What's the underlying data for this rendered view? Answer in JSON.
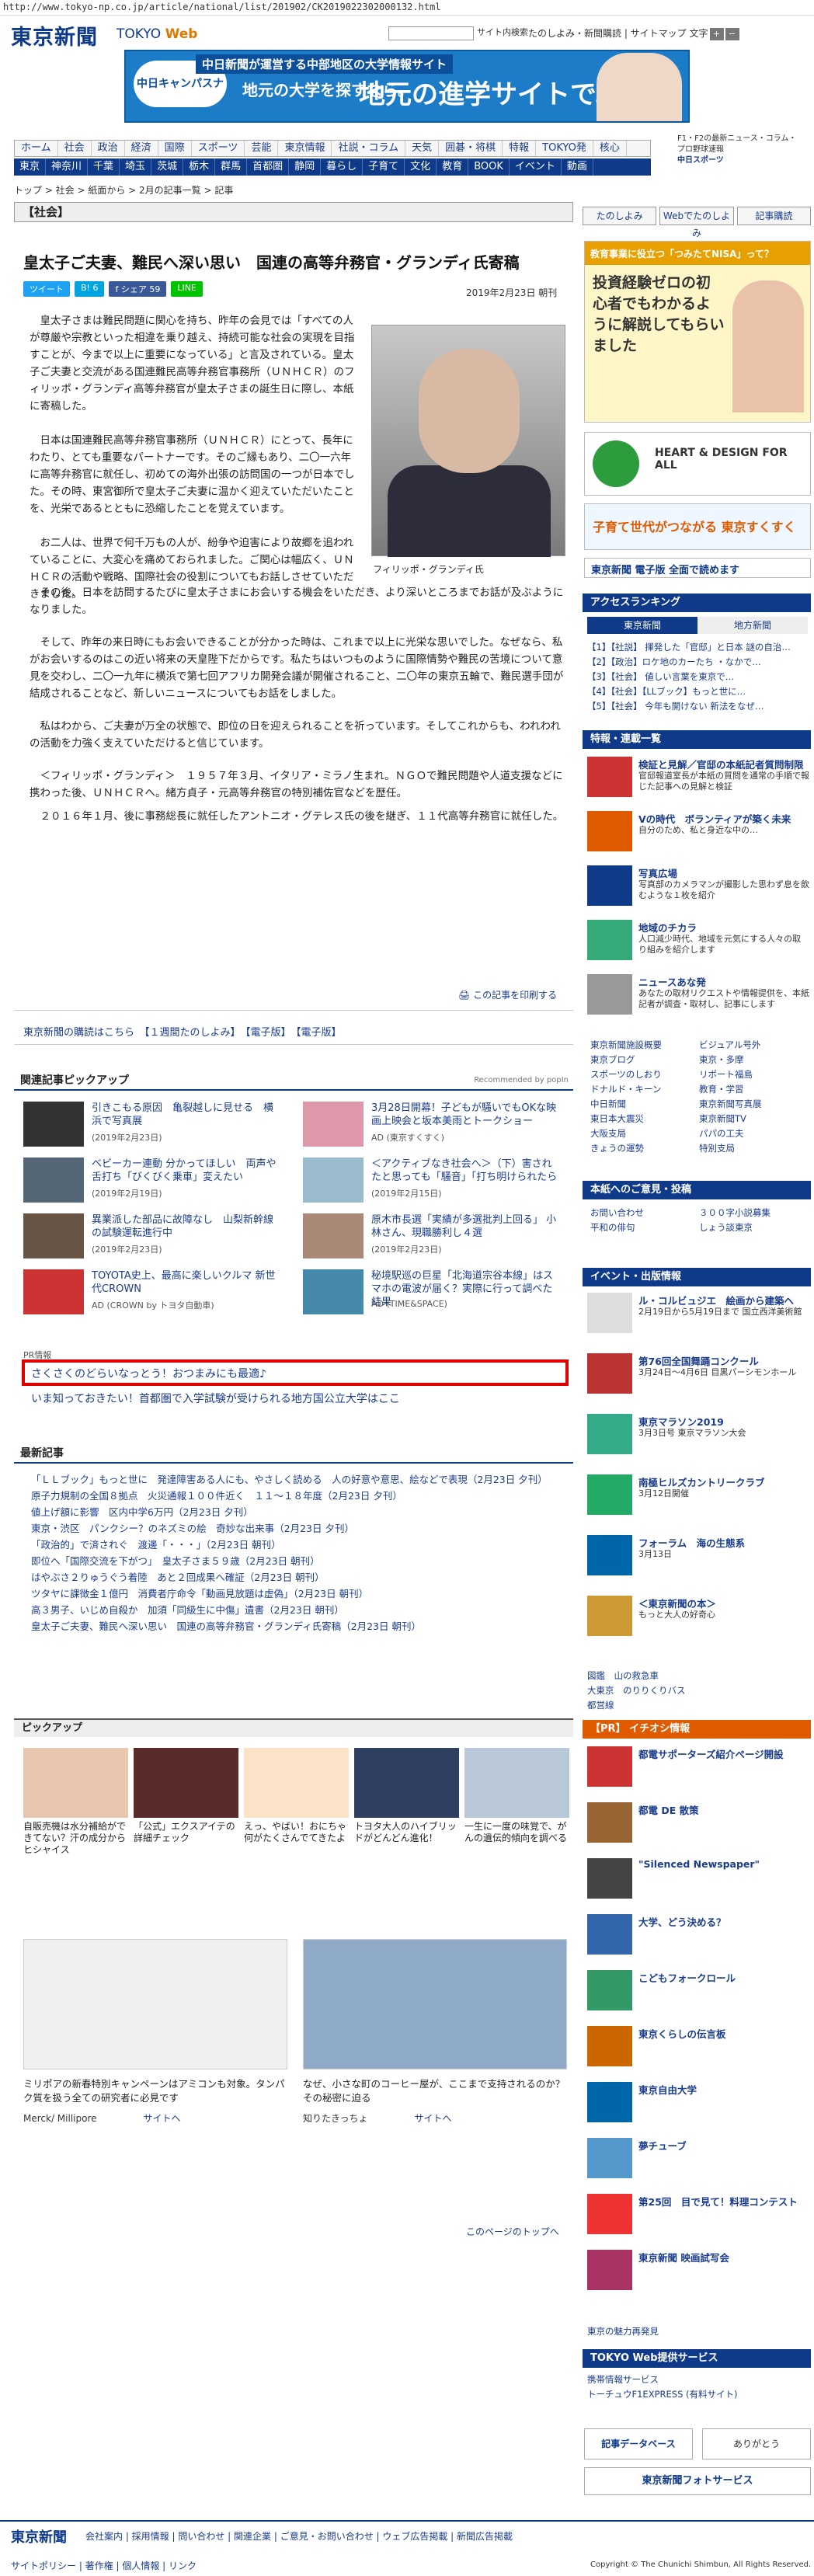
{
  "url": "http://www.tokyo-np.co.jp/article/national/list/201902/CK2019022302000132.html",
  "header": {
    "logo": "東京新聞",
    "logo_sub": "TOKYO",
    "logo_sub2": "Web",
    "search_btn": "サイト内検索",
    "links": "たのしよみ・新聞購読 | サイトマップ",
    "font_label": "文字",
    "font_plus": "+",
    "font_minus": "−"
  },
  "banner": {
    "line1": "中日新聞が運営する中部地区の大学情報サイト",
    "ball": "中日キャンパスナビ",
    "line2": "地元の大学を探すなら。",
    "line3": "地元の進学サイトで。"
  },
  "nav1": [
    "ホーム",
    "社会",
    "政治",
    "経済",
    "国際",
    "スポーツ",
    "芸能",
    "東京情報",
    "社説・コラム",
    "天気",
    "囲碁・将棋",
    "特報",
    "TOKYO発",
    "核心"
  ],
  "nav2": [
    "東京",
    "神奈川",
    "千葉",
    "埼玉",
    "茨城",
    "栃木",
    "群馬",
    "首都圏",
    "静岡",
    "暮らし",
    "子育て",
    "文化",
    "教育",
    "BOOK",
    "イベント",
    "動画"
  ],
  "hdr_right": [
    "F1・F2の最新ニュース・コラム・プロ野球速報",
    "中日スポーツ"
  ],
  "breadcrumb": "トップ > 社会 > 紙面から > 2月の記事一覧 > 記事",
  "category": "【社会】",
  "article": {
    "title": "皇太子ご夫妻、難民へ深い思い　国連の高等弁務官・グランディ氏寄稿",
    "share": [
      "ツイート",
      "B! 6",
      "f シェア 59",
      "LINE"
    ],
    "date": "2019年2月23日 朝刊",
    "p1": "皇太子さまは難民問題に関心を持ち、昨年の会見では「すべての人が尊厳や宗教といった相違を乗り越え、持続可能な社会の実現を目指すことが、今まで以上に重要になっている」と言及されている。皇太子ご夫妻と交流がある国連難民高等弁務官事務所（ＵＮＨＣＲ）のフィリッポ・グランディ高等弁務官が皇太子さまの誕生日に際し、本紙に寄稿した。",
    "p2": "日本は国連難民高等弁務官事務所（ＵＮＨＣＲ）にとって、長年にわたり、とても重要なパートナーです。そのご縁もあり、二〇一六年に高等弁務官に就任し、初めての海外出張の訪問国の一つが日本でした。その時、東宮御所で皇太子ご夫妻に温かく迎えていただいたことを、光栄であるとともに恐縮したことを覚えています。",
    "p3": "お二人は、世界で何千万もの人が、紛争や迫害により故郷を追われていることに、大変心を痛めておられました。ご関心は幅広く、ＵＮＨＣＲの活動や戦略、国際社会の役割についてもお話しさせていただきました。",
    "p4": "その後、日本を訪問するたびに皇太子さまにお会いする機会をいただき、より深いところまでお話が及ぶようになりました。",
    "p5": "そして、昨年の来日時にもお会いできることが分かった時は、これまで以上に光栄な思いでした。なぜなら、私がお会いするのはこの近い将来の天皇陛下だからです。私たちはいつものように国際情勢や難民の苦境について意見を交わし、二〇一九年に横浜で第七回アフリカ開発会議が開催されること、二〇年の東京五輪で、難民選手団が結成されることなど、新しいニュースについてもお話をしました。",
    "p6": "私はわから、ご夫妻が万全の状態で、即位の日を迎えられることを祈っています。そしてこれからも、われわれの活動を力強く支えていただけると信じています。",
    "p7": "＜フィリッポ・グランディ＞　１９５７年３月、イタリア・ミラノ生まれ。ＮＧＯで難民問題や人道支援などに携わった後、ＵＮＨＣＲへ。緒方貞子・元高等弁務官の特別補佐官などを歴任。",
    "p8": "２０１６年１月、後に事務総長に就任したアントニオ・グテレス氏の後を継ぎ、１１代高等弁務官に就任した。",
    "caption": "フィリッポ・グランディ氏",
    "print": "この記事を印刷する"
  },
  "links1": "東京新聞の購読はこちら　【１週間たのしよみ】　【電子版】　【電子版】",
  "related": {
    "heading": "関連記事ピックアップ",
    "powered": "Recommended by popIn",
    "items": [
      {
        "t": "引きこもる原因　亀裂越しに見せる　横浜で写真展",
        "s": "(2019年2月23日)"
      },
      {
        "t": "3月28日開幕！子どもが騒いでもOKな映画上映会と坂本美雨とトークショー",
        "s": "AD (東京すくすく)"
      },
      {
        "t": "ベビーカー連動 分かってほしい　両声や舌打ち「びくびく乗車」変えたい",
        "s": "(2019年2月19日)"
      },
      {
        "t": "＜アクティブなき社会へ＞（下）害されたと思っても「騒音」「打ち明けられたら",
        "s": "(2019年2月15日)"
      },
      {
        "t": "異業派した部品に故障なし　山梨新幹線の試験運転進行中",
        "s": "(2019年2月23日)"
      },
      {
        "t": "原木市長選「実績が多選批判上回る」 小林さん、現職勝利し４選",
        "s": "(2019年2月23日)"
      },
      {
        "t": "TOYOTA史上、最高に楽しいクルマ 新世代CROWN",
        "s": "AD (CROWN by トヨタ自動車)"
      },
      {
        "t": "秘境駅巡の巨星「北海道宗谷本線」はスマホの電波が届く？実際に行って調べた結果",
        "s": "AD (TIME&SPACE)"
      }
    ]
  },
  "pr": {
    "label": "PR情報",
    "item1": "さくさくのどらいなっとう！おつまみにも最適♪",
    "item2": "いま知っておきたい！首都圏で入学試験が受けられる地方国公立大学はここ"
  },
  "latest": {
    "heading": "最新記事",
    "items": [
      "「ＬＬブック」もっと世に　発達障害ある人にも、やさしく読める　人の好意や意思、絵などで表現（2月23日 夕刊）",
      "原子力規制の全国８拠点　火災通報１００件近く　１１～１８年度（2月23日 夕刊）",
      "値上げ額に影響　区内中学6万円（2月23日 夕刊）",
      "東京・渋区　パンクシー？のネズミの絵　奇妙な出来事（2月23日 夕刊）",
      "「政治的」で済されぐ　渡邊「・・・」（2月23日 朝刊）",
      "即位へ「国際交流を下がつ」　皇太子さま５９歳（2月23日 朝刊）",
      "はやぶさ２りゅうぐう着陸　あと２回成果へ確証（2月23日 朝刊）",
      "ツタヤに課徴金１億円　消費者庁命令「動画見放題は虚偽」（2月23日 朝刊）",
      "高３男子、いじめ自殺か　加須「同級生に中傷」遺書（2月23日 朝刊）",
      "皇太子ご夫妻、難民へ深い思い　国連の高等弁務官・グランディ氏寄稿（2月23日 朝刊）"
    ]
  },
  "pickup": {
    "heading": "ピックアップ",
    "items": [
      {
        "t": "自販売機は水分補給ができてない？汗の成分からヒシャイス"
      },
      {
        "t": "「公式」エクスアイテの詳細チェック"
      },
      {
        "t": "えっ、やばい！おにちゃ何がたくさんでてきたよ"
      },
      {
        "t": "トヨタ大人のハイブリッドがどんどん進化！"
      },
      {
        "t": "一生に一度の味覚で、がんの遺伝的傾向を調べる"
      }
    ]
  },
  "ads": [
    {
      "t": "ミリポアの新春特別キャンペーンはアミコンも対象。タンパク質を扱う全ての研究者に必見です",
      "s": "Merck/ Millipore",
      "link": "サイトへ"
    },
    {
      "t": "なぜ、小さな町のコーヒー屋が、ここまで支持されるのか？その秘密に迫る",
      "s": "知りたきっちょ",
      "link": "サイトへ"
    }
  ],
  "totop": "このページのトップへ",
  "side": {
    "buttons": [
      "たのしよみ",
      "Webでたのしよみ",
      "記事購読"
    ],
    "ad1": {
      "l1": "教育事業に役立つ「つみたてNISA」って？",
      "l2": "投資経験ゼロの初心者でもわかるように解説してもらいました"
    },
    "ad2": {
      "l1": "HEART & DESIGN FOR ALL"
    },
    "ad3": {
      "l1": "子育て世代がつながる 東京すくすく"
    },
    "paper": "東京新聞 電子版 全面で読めます",
    "ranking_h": "アクセスランキング",
    "ranking_tabs": [
      "東京新聞",
      "地方新聞"
    ],
    "ranking": [
      "【1】【社説】 揮発した「官邸」と日本 謎の自治…",
      "【2】【政治】ロケ地のカーたち ・なかで…",
      "【3】【社会】 値しい言葉を東京で…",
      "【4】【社会】【LLブック】もっと世に…",
      "【5】【社会】 今年も開けない 新法をなぜ…"
    ],
    "tokuho_h": "特報・連載一覧",
    "tokuho": [
      {
        "t": "検証と見解／官邸の本紙記者質問制限",
        "d": "官邸報道室長が本紙の質問を通常の手順で報じた記事への見解と検証"
      },
      {
        "t": "Vの時代　ボランティアが築く未来",
        "d": "自分のため、私と身近な中の…"
      },
      {
        "t": "写真広場",
        "d": "写真部のカメラマンが撮影した思わず息を飲むような１枚を紹介"
      },
      {
        "t": "地域のチカラ",
        "d": "人口減少時代、地域を元気にする人々の取り組みを紹介します"
      },
      {
        "t": "ニュースあな発",
        "d": "あなたの取材リクエストや情報提供を、本紙記者が調査・取材し、記事にします"
      }
    ],
    "grid1": [
      "東京新聞施設概要",
      "ビジュアル号外",
      "東京ブログ",
      "東京・多摩",
      "スポーツのしおり",
      "リポート福島",
      "ドナルド・キーン",
      "教育・学習",
      "中日新聞",
      "東京新聞写真展",
      "東日本大震災",
      "東京新聞TV",
      "大阪支局",
      "パパの工夫",
      "きょうの運勢",
      "特別支局"
    ],
    "info_h": "本紙へのご意見・投稿",
    "grid2": [
      "お問い合わせ",
      "３００字小説募集",
      "平和の俳句",
      "しょう談東京"
    ],
    "event_h": "イベント・出版情報",
    "events": [
      {
        "t": "ル・コルビュジエ　絵画から建築へ",
        "d": "2月19日から5月19日まで 国立西洋美術館"
      },
      {
        "t": "第76回全国舞踊コンクール",
        "d": "3月24日～4月6日 目黒パーシモンホール"
      },
      {
        "t": "東京マラソン2019",
        "d": "3月3日号 東京マラソン大会"
      },
      {
        "t": "南極ヒルズカントリークラブ",
        "d": "3月12日開催"
      },
      {
        "t": "フォーラム　海の生態系",
        "d": "3月13日"
      },
      {
        "t": "＜東京新聞の本＞",
        "d": "もっと大人の好奇心"
      }
    ],
    "tokyo_links": [
      "図鑑　山の救急車",
      "大東京　のりりくりバス",
      "都営線"
    ],
    "pr_h": "【PR】 イチオシ情報",
    "pr_items": [
      {
        "t": "都電サポーターズ紹介ページ開設",
        "d": ""
      },
      {
        "t": "都電 DE 散策",
        "d": ""
      },
      {
        "t": "\"Silenced Newspaper\"",
        "d": ""
      },
      {
        "t": "大学、どう決める？",
        "d": ""
      },
      {
        "t": "こどもフォークロール",
        "d": ""
      },
      {
        "t": "東京くらしの伝言板",
        "d": ""
      },
      {
        "t": "東京自由大学",
        "d": ""
      },
      {
        "t": "夢チューブ",
        "d": ""
      },
      {
        "t": "第25回　目で見て！料理コンテスト",
        "d": ""
      },
      {
        "t": "東京新聞 映画試写会",
        "d": ""
      }
    ],
    "appeal": "東京の魅力再発見",
    "web_h": "TOKYO Web提供サービス",
    "web": [
      "携帯情報サービス",
      "トーチュウF1EXPRESS (有料サイト)"
    ],
    "bottom": [
      "記事データベース",
      "ありがとう",
      "東京新聞フォトサービス"
    ]
  },
  "footer": {
    "logo": "東京新聞",
    "links": "会社案内 | 採用情報 | 問い合わせ | 関連企業 | ご意見・お問い合わせ | ウェブ広告掲載 | 新聞広告掲載",
    "links2": "サイトポリシー | 著作権 | 個人情報 | リンク",
    "copy": "Copyright © The Chunichi Shimbun, All Rights Reserved."
  }
}
